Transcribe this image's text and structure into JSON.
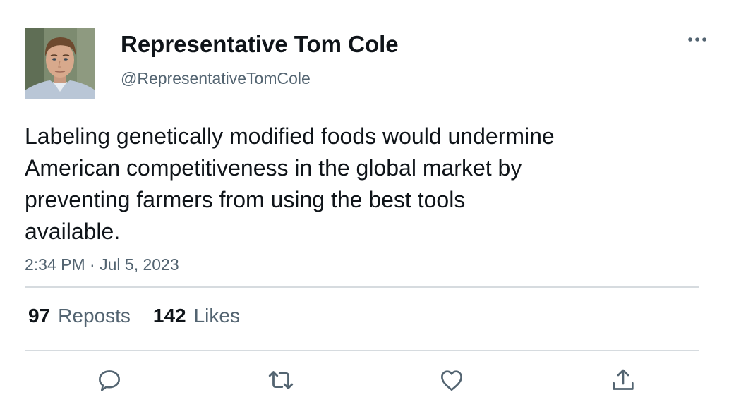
{
  "author": {
    "display_name": "Representative Tom Cole",
    "handle": "@RepresentativeTomCole",
    "avatar_icon": "profile-photo"
  },
  "tweet": {
    "text": "Labeling genetically modified foods would undermine\nAmerican competitiveness in the global market by\npreventing farmers from using the best tools\navailable.",
    "time": "2:34 PM",
    "separator": "·",
    "date": "Jul 5, 2023"
  },
  "stats": {
    "reposts_count": "97",
    "reposts_label": "Reposts",
    "likes_count": "142",
    "likes_label": "Likes"
  },
  "actions": [
    {
      "icon": "reply-icon"
    },
    {
      "icon": "repost-icon"
    },
    {
      "icon": "like-icon"
    },
    {
      "icon": "share-icon"
    }
  ],
  "colors": {
    "text_primary": "#0f1419",
    "text_secondary": "#536471",
    "divider": "#d6dbdf",
    "icon": "#536471"
  }
}
